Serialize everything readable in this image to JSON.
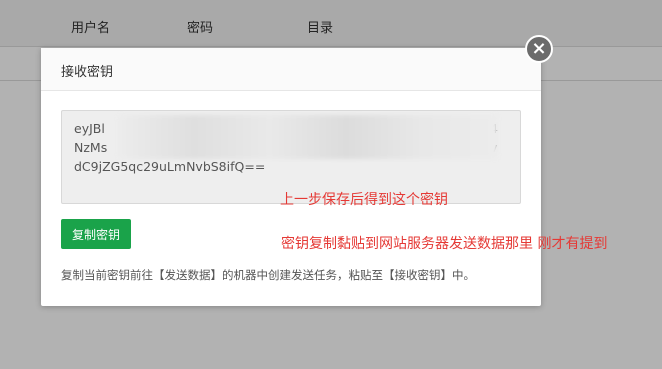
{
  "table": {
    "columns": [
      "用户名",
      "密码",
      "目录"
    ]
  },
  "modal": {
    "title": "接收密钥",
    "key_lines": [
      "eyJBl",
      "NzMs",
      "dC9jZG5qc29uLmNvbS8ifQ=="
    ],
    "key_line1_tail": "4",
    "key_line2_tail": "v",
    "copy_button_label": "复制密钥",
    "hint": "复制当前密钥前往【发送数据】的机器中创建发送任务，粘贴至【接收密钥】中。",
    "close_icon": "close-icon"
  },
  "annotations": {
    "note1": "上一步保存后得到这个密钥",
    "note2": "密钥复制黏贴到网站服务器发送数据那里 刚才有提到"
  },
  "colors": {
    "copy_button": "#1aa34a",
    "annotation_text": "#e53935",
    "close_button": "#6b6b6b"
  }
}
